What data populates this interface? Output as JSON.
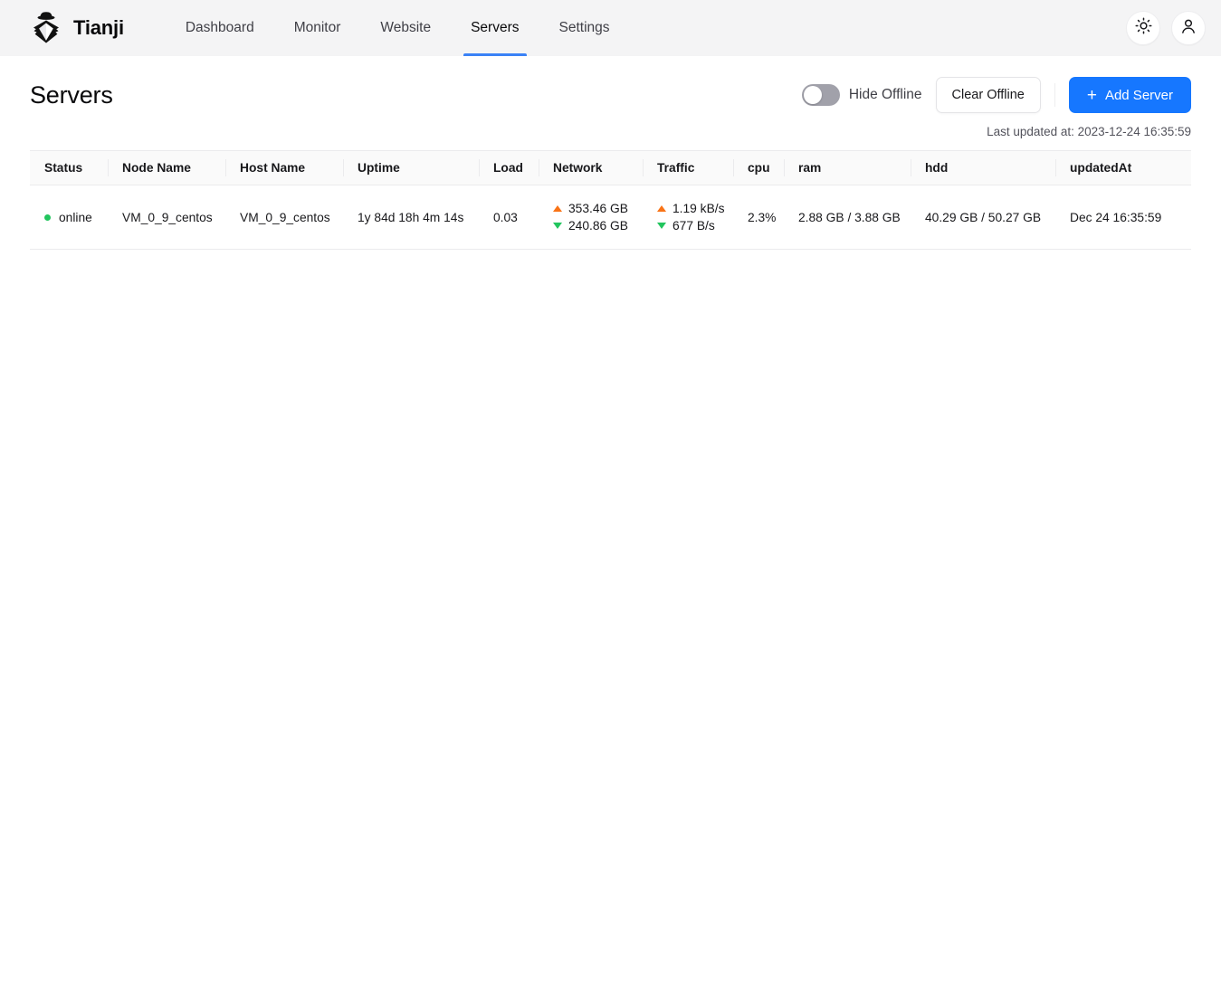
{
  "app": {
    "brand_name": "Tianji",
    "logo_icon": "detective-logo-icon"
  },
  "nav": {
    "links": [
      {
        "label": "Dashboard",
        "active": false
      },
      {
        "label": "Monitor",
        "active": false
      },
      {
        "label": "Website",
        "active": false
      },
      {
        "label": "Servers",
        "active": true
      },
      {
        "label": "Settings",
        "active": false
      }
    ],
    "theme_toggle_icon": "sun-icon",
    "account_icon": "user-avatar-icon"
  },
  "page": {
    "title": "Servers",
    "hide_offline_label": "Hide Offline",
    "hide_offline_enabled": false,
    "clear_offline_label": "Clear Offline",
    "add_server_label": "Add Server",
    "add_server_icon": "plus-icon",
    "last_updated": "Last updated at: 2023-12-24 16:35:59"
  },
  "table": {
    "columns": [
      "Status",
      "Node Name",
      "Host Name",
      "Uptime",
      "Load",
      "Network",
      "Traffic",
      "cpu",
      "ram",
      "hdd",
      "updatedAt"
    ],
    "rows": [
      {
        "status": "online",
        "node_name": "VM_0_9_centos",
        "host_name": "VM_0_9_centos",
        "uptime": "1y 84d 18h 4m 14s",
        "load": "0.03",
        "network_up": "353.46 GB",
        "network_down": "240.86 GB",
        "traffic_up": "1.19 kB/s",
        "traffic_down": "677 B/s",
        "cpu": "2.3%",
        "ram": "2.88 GB / 3.88 GB",
        "hdd": "40.29 GB / 50.27 GB",
        "updated_at": "Dec 24 16:35:59"
      }
    ]
  },
  "colors": {
    "accent": "#1677ff",
    "nav_bg": "#f4f4f5",
    "online": "#22c55e",
    "up_arrow": "#f97316",
    "down_arrow": "#22c55e"
  }
}
